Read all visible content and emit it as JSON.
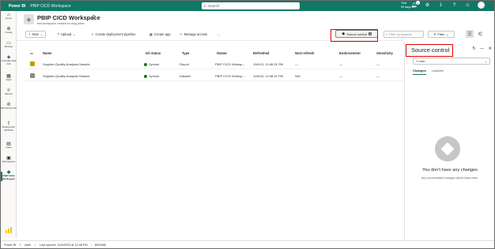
{
  "topbar": {
    "app_name": "Power BI",
    "workspace": "PBIP CICD Workspace",
    "search_placeholder": "Search",
    "trial_line1": "Trial:",
    "trial_line2": "59 days left",
    "notifications_count": "1"
  },
  "leftnav": {
    "items": [
      {
        "label": "Home",
        "icon": "home-icon"
      },
      {
        "label": "Create",
        "icon": "plus-circle-icon"
      },
      {
        "label": "Browse",
        "icon": "folder-icon"
      },
      {
        "label": "OneLake data hub",
        "icon": "hub-icon"
      },
      {
        "label": "Apps",
        "icon": "apps-icon"
      },
      {
        "label": "Metrics",
        "icon": "trophy-icon"
      },
      {
        "label": "Monitoring hub",
        "icon": "monitor-icon"
      },
      {
        "label": "Deployment pipelines",
        "icon": "rocket-icon"
      },
      {
        "label": "Learn",
        "icon": "book-icon"
      },
      {
        "label": "Workspaces",
        "icon": "workspaces-icon"
      },
      {
        "label": "PBIP CICD Workspace",
        "icon": "workspace-icon"
      }
    ],
    "footer_label": "Power BI"
  },
  "header": {
    "title": "PBIP CICD Workspace",
    "subtitle": "test workspace created for blog piece"
  },
  "toolbar": {
    "new_label": "New",
    "upload_label": "Upload",
    "pipeline_label": "Create deployment pipeline",
    "create_app_label": "Create app",
    "manage_access_label": "Manage access",
    "more_label": "...",
    "source_control_label": "Source control",
    "source_control_count": "0",
    "filter_placeholder": "Filter by keyword",
    "filter_label": "Filter"
  },
  "table": {
    "headers": [
      "Name",
      "Git status",
      "Type",
      "Owner",
      "Refreshed",
      "Next refresh",
      "Endorsement",
      "Sensitivity"
    ],
    "rows": [
      {
        "name": "Supplier-Quality-Analysis-Sample",
        "git": "Synced",
        "type": "Report",
        "owner": "PBIP CICD Worksp...",
        "refreshed": "11/6/23, 12:48:31 PM",
        "next": "—",
        "endorsement": "—",
        "sensitivity": "—"
      },
      {
        "name": "Supplier-Quality-Analysis-Sample",
        "git": "Synced",
        "type": "Dataset",
        "owner": "PBIP CICD Worksp...",
        "refreshed": "11/6/23, 12:48:31 PM",
        "next": "N/A",
        "endorsement": "—",
        "sensitivity": "—"
      }
    ]
  },
  "panel": {
    "title": "Source control",
    "branch": "main",
    "tabs": [
      "Changes",
      "Updates"
    ],
    "empty_title": "You don't have any changes",
    "empty_sub": "Any uncommitted changes will be listed here."
  },
  "statusbar": {
    "brand": "Power BI",
    "branch": "main",
    "last_synced": "Last synced: 11/6/2023 at 12:48 PM",
    "commit": "8920df8"
  }
}
